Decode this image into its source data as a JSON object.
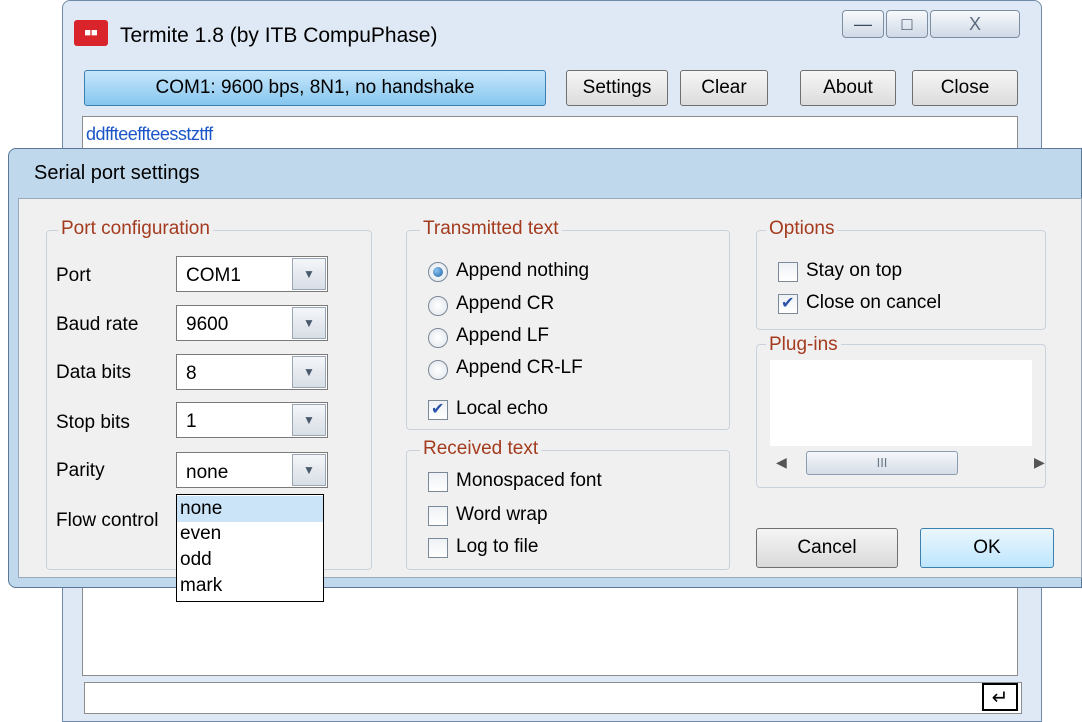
{
  "main_window": {
    "title": "Termite 1.8 (by ITB CompuPhase)",
    "icon_text": "■■",
    "min_glyph": "—",
    "max_glyph": "□",
    "close_glyph": "X"
  },
  "toolbar": {
    "port_status": "COM1: 9600 bps, 8N1, no handshake",
    "settings_label": "Settings",
    "clear_label": "Clear",
    "about_label": "About",
    "close_label": "Close"
  },
  "terminal": {
    "text": "ddffteeffteesstztff",
    "text_color": "#1a55c8",
    "enter_glyph": "↵"
  },
  "dialog": {
    "title": "Serial port settings",
    "port_config": {
      "heading": "Port configuration",
      "fields": [
        {
          "label": "Port",
          "value": "COM1"
        },
        {
          "label": "Baud rate",
          "value": "9600"
        },
        {
          "label": "Data bits",
          "value": "8"
        },
        {
          "label": "Stop bits",
          "value": "1"
        },
        {
          "label": "Parity",
          "value": "none"
        },
        {
          "label": "Flow control",
          "value": ""
        }
      ],
      "parity_options": [
        "none",
        "even",
        "odd",
        "mark"
      ],
      "parity_selected": "none"
    },
    "transmitted": {
      "heading": "Transmitted text",
      "append_options": [
        "Append nothing",
        "Append CR",
        "Append LF",
        "Append CR-LF"
      ],
      "append_selected": "Append nothing",
      "local_echo_label": "Local echo",
      "local_echo": true
    },
    "received": {
      "heading": "Received text",
      "monospaced_label": "Monospaced font",
      "monospaced": false,
      "word_wrap_label": "Word wrap",
      "word_wrap": false,
      "log_label": "Log to file",
      "log": false
    },
    "options": {
      "heading": "Options",
      "stay_on_top_label": "Stay on top",
      "stay_on_top": false,
      "close_on_cancel_label": "Close on cancel",
      "close_on_cancel": true
    },
    "plugins": {
      "heading": "Plug-ins",
      "scroll_left": "◀",
      "scroll_thumb": "III",
      "scroll_right": "▶"
    },
    "cancel_label": "Cancel",
    "ok_label": "OK"
  },
  "colors": {
    "group_label": "#a43a1e",
    "accent_button": "#86c6ee",
    "dropdown_selection": "#cce4f7"
  }
}
